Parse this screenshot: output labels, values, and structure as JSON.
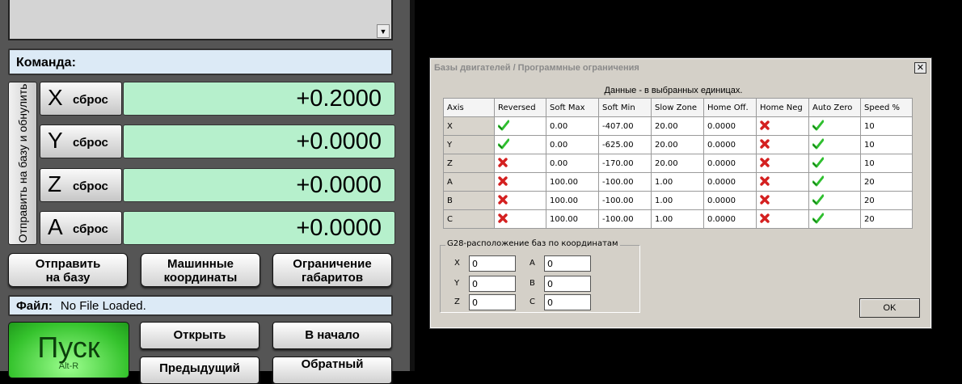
{
  "left_panel": {
    "command_label": "Команда:",
    "ref_all_label": "Отправить на базу и обнулить",
    "axes": [
      {
        "letter": "X",
        "reset_label": "сброс",
        "value": "+0.2000"
      },
      {
        "letter": "Y",
        "reset_label": "сброс",
        "value": "+0.0000"
      },
      {
        "letter": "Z",
        "reset_label": "сброс",
        "value": "+0.0000"
      },
      {
        "letter": "A",
        "reset_label": "сброс",
        "value": "+0.0000"
      }
    ],
    "buttons": {
      "ref_home": [
        "Отправить",
        "на базу"
      ],
      "machine_coords": [
        "Машинные",
        "координаты"
      ],
      "soft_limits": [
        "Ограничение",
        "габаритов"
      ]
    },
    "file_label": "Файл:",
    "file_value": "No File Loaded.",
    "start_label": "Пуск",
    "start_hotkey": "Alt-R",
    "open_label": "Открыть",
    "rewind_label": "В начало",
    "prev_label": "Предыдущий",
    "reverse_label": "Обратный"
  },
  "dialog": {
    "title": "Базы двигателей / Программные ограничения",
    "close_glyph": "✕",
    "caption": "Данные - в выбранных единицах.",
    "columns": [
      "Axis",
      "Reversed",
      "Soft Max",
      "Soft Min",
      "Slow Zone",
      "Home Off.",
      "Home Neg",
      "Auto Zero",
      "Speed %"
    ],
    "rows": [
      {
        "axis": "X",
        "reversed": true,
        "soft_max": "0.00",
        "soft_min": "-407.00",
        "slow_zone": "20.00",
        "home_off": "0.0000",
        "home_neg": false,
        "auto_zero": true,
        "speed": "10"
      },
      {
        "axis": "Y",
        "reversed": true,
        "soft_max": "0.00",
        "soft_min": "-625.00",
        "slow_zone": "20.00",
        "home_off": "0.0000",
        "home_neg": false,
        "auto_zero": true,
        "speed": "10"
      },
      {
        "axis": "Z",
        "reversed": false,
        "soft_max": "0.00",
        "soft_min": "-170.00",
        "slow_zone": "20.00",
        "home_off": "0.0000",
        "home_neg": false,
        "auto_zero": true,
        "speed": "10"
      },
      {
        "axis": "A",
        "reversed": false,
        "soft_max": "100.00",
        "soft_min": "-100.00",
        "slow_zone": "1.00",
        "home_off": "0.0000",
        "home_neg": false,
        "auto_zero": true,
        "speed": "20"
      },
      {
        "axis": "B",
        "reversed": false,
        "soft_max": "100.00",
        "soft_min": "-100.00",
        "slow_zone": "1.00",
        "home_off": "0.0000",
        "home_neg": false,
        "auto_zero": true,
        "speed": "20"
      },
      {
        "axis": "C",
        "reversed": false,
        "soft_max": "100.00",
        "soft_min": "-100.00",
        "slow_zone": "1.00",
        "home_off": "0.0000",
        "home_neg": false,
        "auto_zero": true,
        "speed": "20"
      }
    ],
    "g28": {
      "legend": "G28-расположение баз по координатам",
      "fields": [
        {
          "label": "X",
          "value": "0"
        },
        {
          "label": "A",
          "value": "0"
        },
        {
          "label": "Y",
          "value": "0"
        },
        {
          "label": "B",
          "value": "0"
        },
        {
          "label": "Z",
          "value": "0"
        },
        {
          "label": "C",
          "value": "0"
        }
      ]
    },
    "ok_label": "OK"
  },
  "colors": {
    "dro_green": "#b6f0cc",
    "check_green": "#2fbf2f",
    "cross_red": "#d42020",
    "start_green": "#35c32d"
  }
}
